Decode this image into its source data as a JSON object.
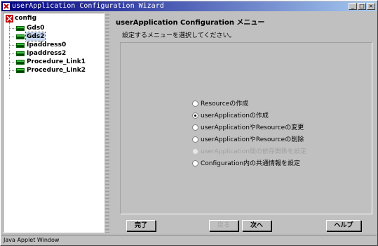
{
  "window": {
    "title": "userApplication Configuration Wizard",
    "minimize_glyph": "_",
    "maximize_glyph": "□",
    "close_glyph": "×"
  },
  "tree": {
    "root": {
      "label": "config",
      "icon": "config-icon"
    },
    "items": [
      {
        "label": "Gds0",
        "icon": "node-icon",
        "selected": false
      },
      {
        "label": "Gds2",
        "icon": "node-icon",
        "selected": true
      },
      {
        "label": "Ipaddress0",
        "icon": "node-icon",
        "selected": false
      },
      {
        "label": "Ipaddress2",
        "icon": "node-icon",
        "selected": false
      },
      {
        "label": "Procedure_Link1",
        "icon": "node-icon",
        "selected": false
      },
      {
        "label": "Procedure_Link2",
        "icon": "node-icon",
        "selected": false
      }
    ]
  },
  "main": {
    "heading": "userApplication Configuration メニュー",
    "instruction": "設定するメニューを選択してください。",
    "options": [
      {
        "label": "Resourceの作成",
        "checked": false,
        "enabled": true
      },
      {
        "label": "userApplicationの作成",
        "checked": true,
        "enabled": true
      },
      {
        "label": "userApplicationやResourceの変更",
        "checked": false,
        "enabled": true
      },
      {
        "label": "userApplicationやResourceの削除",
        "checked": false,
        "enabled": true
      },
      {
        "label": "userApplication間の依存関係を設定",
        "checked": false,
        "enabled": false
      },
      {
        "label": "Configuration内の共通情報を設定",
        "checked": false,
        "enabled": true
      }
    ]
  },
  "buttons": {
    "finish": "完了",
    "back": "戻る",
    "next": "次へ",
    "help": "ヘルプ"
  },
  "status": {
    "text": "Java Applet Window"
  },
  "colors": {
    "titlebar_start": "#000080",
    "titlebar_end": "#a6caf0",
    "selection": "#c8d8f0",
    "window_bg": "#c0c0c0"
  }
}
